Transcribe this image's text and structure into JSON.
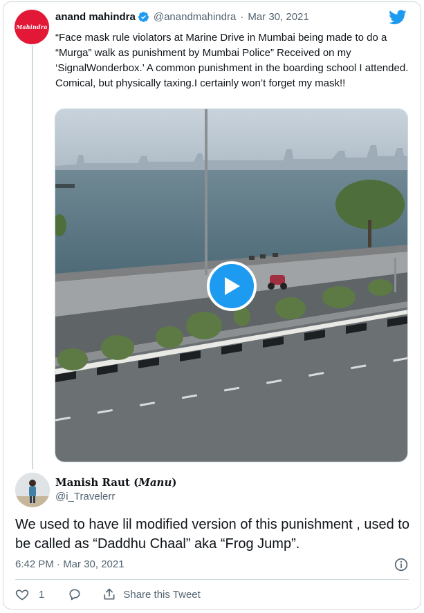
{
  "tweet": {
    "author_name": "anand mahindra",
    "handle": "@anandmahindra",
    "separator": "·",
    "date": "Mar 30, 2021",
    "avatar_text": "Mahindra",
    "text": "“Face mask rule violators at Marine Drive in Mumbai being made to do a “Murga” walk as punishment by Mumbai Police” Received on my ‘SignalWonderbox.’ A common punishment in the boarding school I attended. Comical, but physically taxing.I certainly won’t forget my mask!!"
  },
  "reply": {
    "author_name": "Manish Raut",
    "nickname": "Manu",
    "handle": "@i_Travelerr",
    "text": "We used to have lil modified version of this punishment , used to be called as “Daddhu Chaal” aka “Frog Jump”.",
    "timestamp": "6:42 PM · Mar 30, 2021"
  },
  "actions": {
    "like_count": "1",
    "share_label": "Share this Tweet"
  },
  "icons": {
    "brand": "twitter-bird-icon",
    "verified": "verified-badge-icon",
    "play": "play-icon",
    "info": "info-icon",
    "like": "heart-icon",
    "reply": "reply-bubble-icon",
    "share": "share-icon"
  },
  "colors": {
    "twitter_blue": "#1d9bf0",
    "secondary_text": "#536471",
    "border": "#cfd9de",
    "mahindra_red": "#e31837"
  }
}
